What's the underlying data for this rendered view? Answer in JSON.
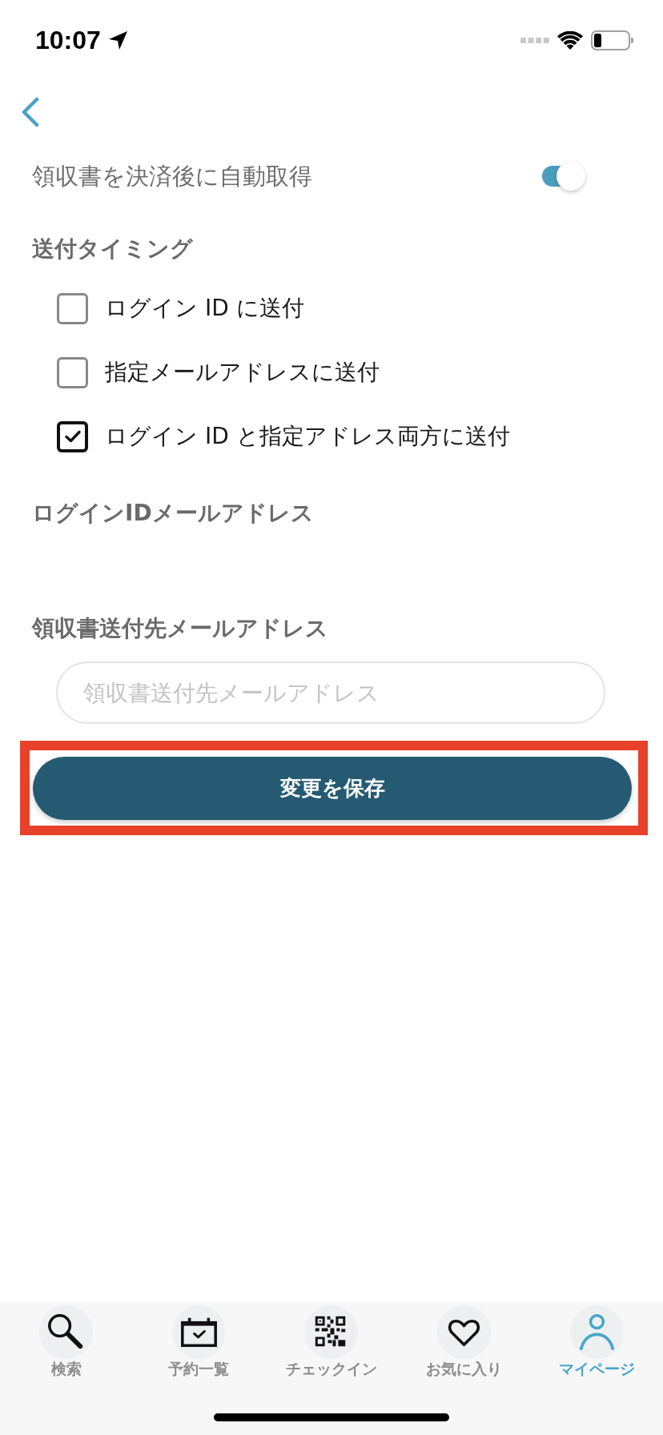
{
  "status_bar": {
    "time": "10:07"
  },
  "auto_receipt": {
    "label": "領収書を決済後に自動取得",
    "on": true
  },
  "send_timing": {
    "heading": "送付タイミング",
    "options": [
      {
        "label": "ログイン ID に送付",
        "checked": false
      },
      {
        "label": "指定メールアドレスに送付",
        "checked": false
      },
      {
        "label": "ログイン ID と指定アドレス両方に送付",
        "checked": true
      }
    ]
  },
  "login_id_email": {
    "heading": "ログインIDメールアドレス"
  },
  "receipt_email": {
    "heading": "領収書送付先メールアドレス",
    "placeholder": "領収書送付先メールアドレス"
  },
  "save_button": {
    "label": "変更を保存",
    "highlighted": true
  },
  "tab_bar": [
    {
      "kind": "search",
      "label": "検索",
      "selected": false
    },
    {
      "kind": "calendar",
      "label": "予約一覧",
      "selected": false
    },
    {
      "kind": "qr",
      "label": "チェックイン",
      "selected": false
    },
    {
      "kind": "heart",
      "label": "お気に入り",
      "selected": false
    },
    {
      "kind": "person",
      "label": "マイページ",
      "selected": true
    }
  ]
}
